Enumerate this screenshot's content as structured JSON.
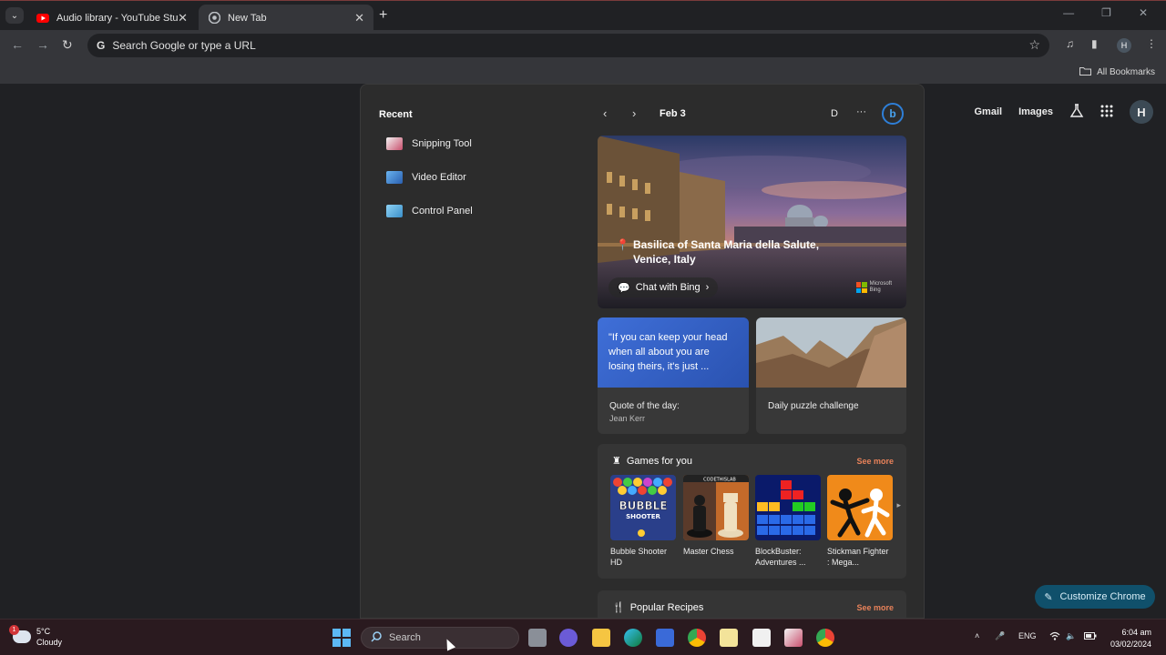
{
  "browser": {
    "tabs": [
      {
        "title": "Audio library - YouTube Studio",
        "active": false
      },
      {
        "title": "New Tab",
        "active": true
      }
    ],
    "omnibox_placeholder": "Search Google or type a URL",
    "profile_initial": "H",
    "all_bookmarks": "All Bookmarks"
  },
  "google_nav": {
    "gmail": "Gmail",
    "images": "Images",
    "avatar": "H"
  },
  "customize_chrome": "Customize Chrome",
  "widgets": {
    "recent_title": "Recent",
    "recent_items": [
      {
        "label": "Snipping Tool",
        "icon": "snipping-tool-icon"
      },
      {
        "label": "Video Editor",
        "icon": "video-editor-icon"
      },
      {
        "label": "Control Panel",
        "icon": "control-panel-icon"
      }
    ],
    "date": "Feb 3",
    "user_initial": "D",
    "more": "···",
    "hero": {
      "location": "Basilica of Santa Maria della Salute, Venice, Italy",
      "chat_label": "Chat with Bing",
      "brand": [
        "Microsoft",
        "Bing"
      ]
    },
    "quote_card": {
      "quote": "\"If you can keep your head when all about you are losing theirs, it's just ...",
      "label": "Quote of the day:",
      "author": "Jean Kerr"
    },
    "puzzle_card": {
      "label": "Daily puzzle challenge"
    },
    "games": {
      "title": "Games for you",
      "see_more": "See more",
      "items": [
        {
          "name": "Bubble Shooter HD",
          "logo": "BUBBLE SHOOTER"
        },
        {
          "name": "Master Chess",
          "logo": "CODETHISLAB"
        },
        {
          "name": "BlockBuster: Adventures ..."
        },
        {
          "name": "Stickman Fighter : Mega..."
        }
      ]
    },
    "recipes": {
      "title": "Popular Recipes",
      "see_more": "See more"
    }
  },
  "taskbar": {
    "weather_temp": "5°C",
    "weather_desc": "Cloudy",
    "weather_badge": "1",
    "search_placeholder": "Search",
    "language": "ENG",
    "time": "6:04 am",
    "date": "03/02/2024"
  },
  "colors": {
    "accent_orange": "#e8825a",
    "quote_blue": "#3f6fd8",
    "customize_bg": "#10506b"
  }
}
